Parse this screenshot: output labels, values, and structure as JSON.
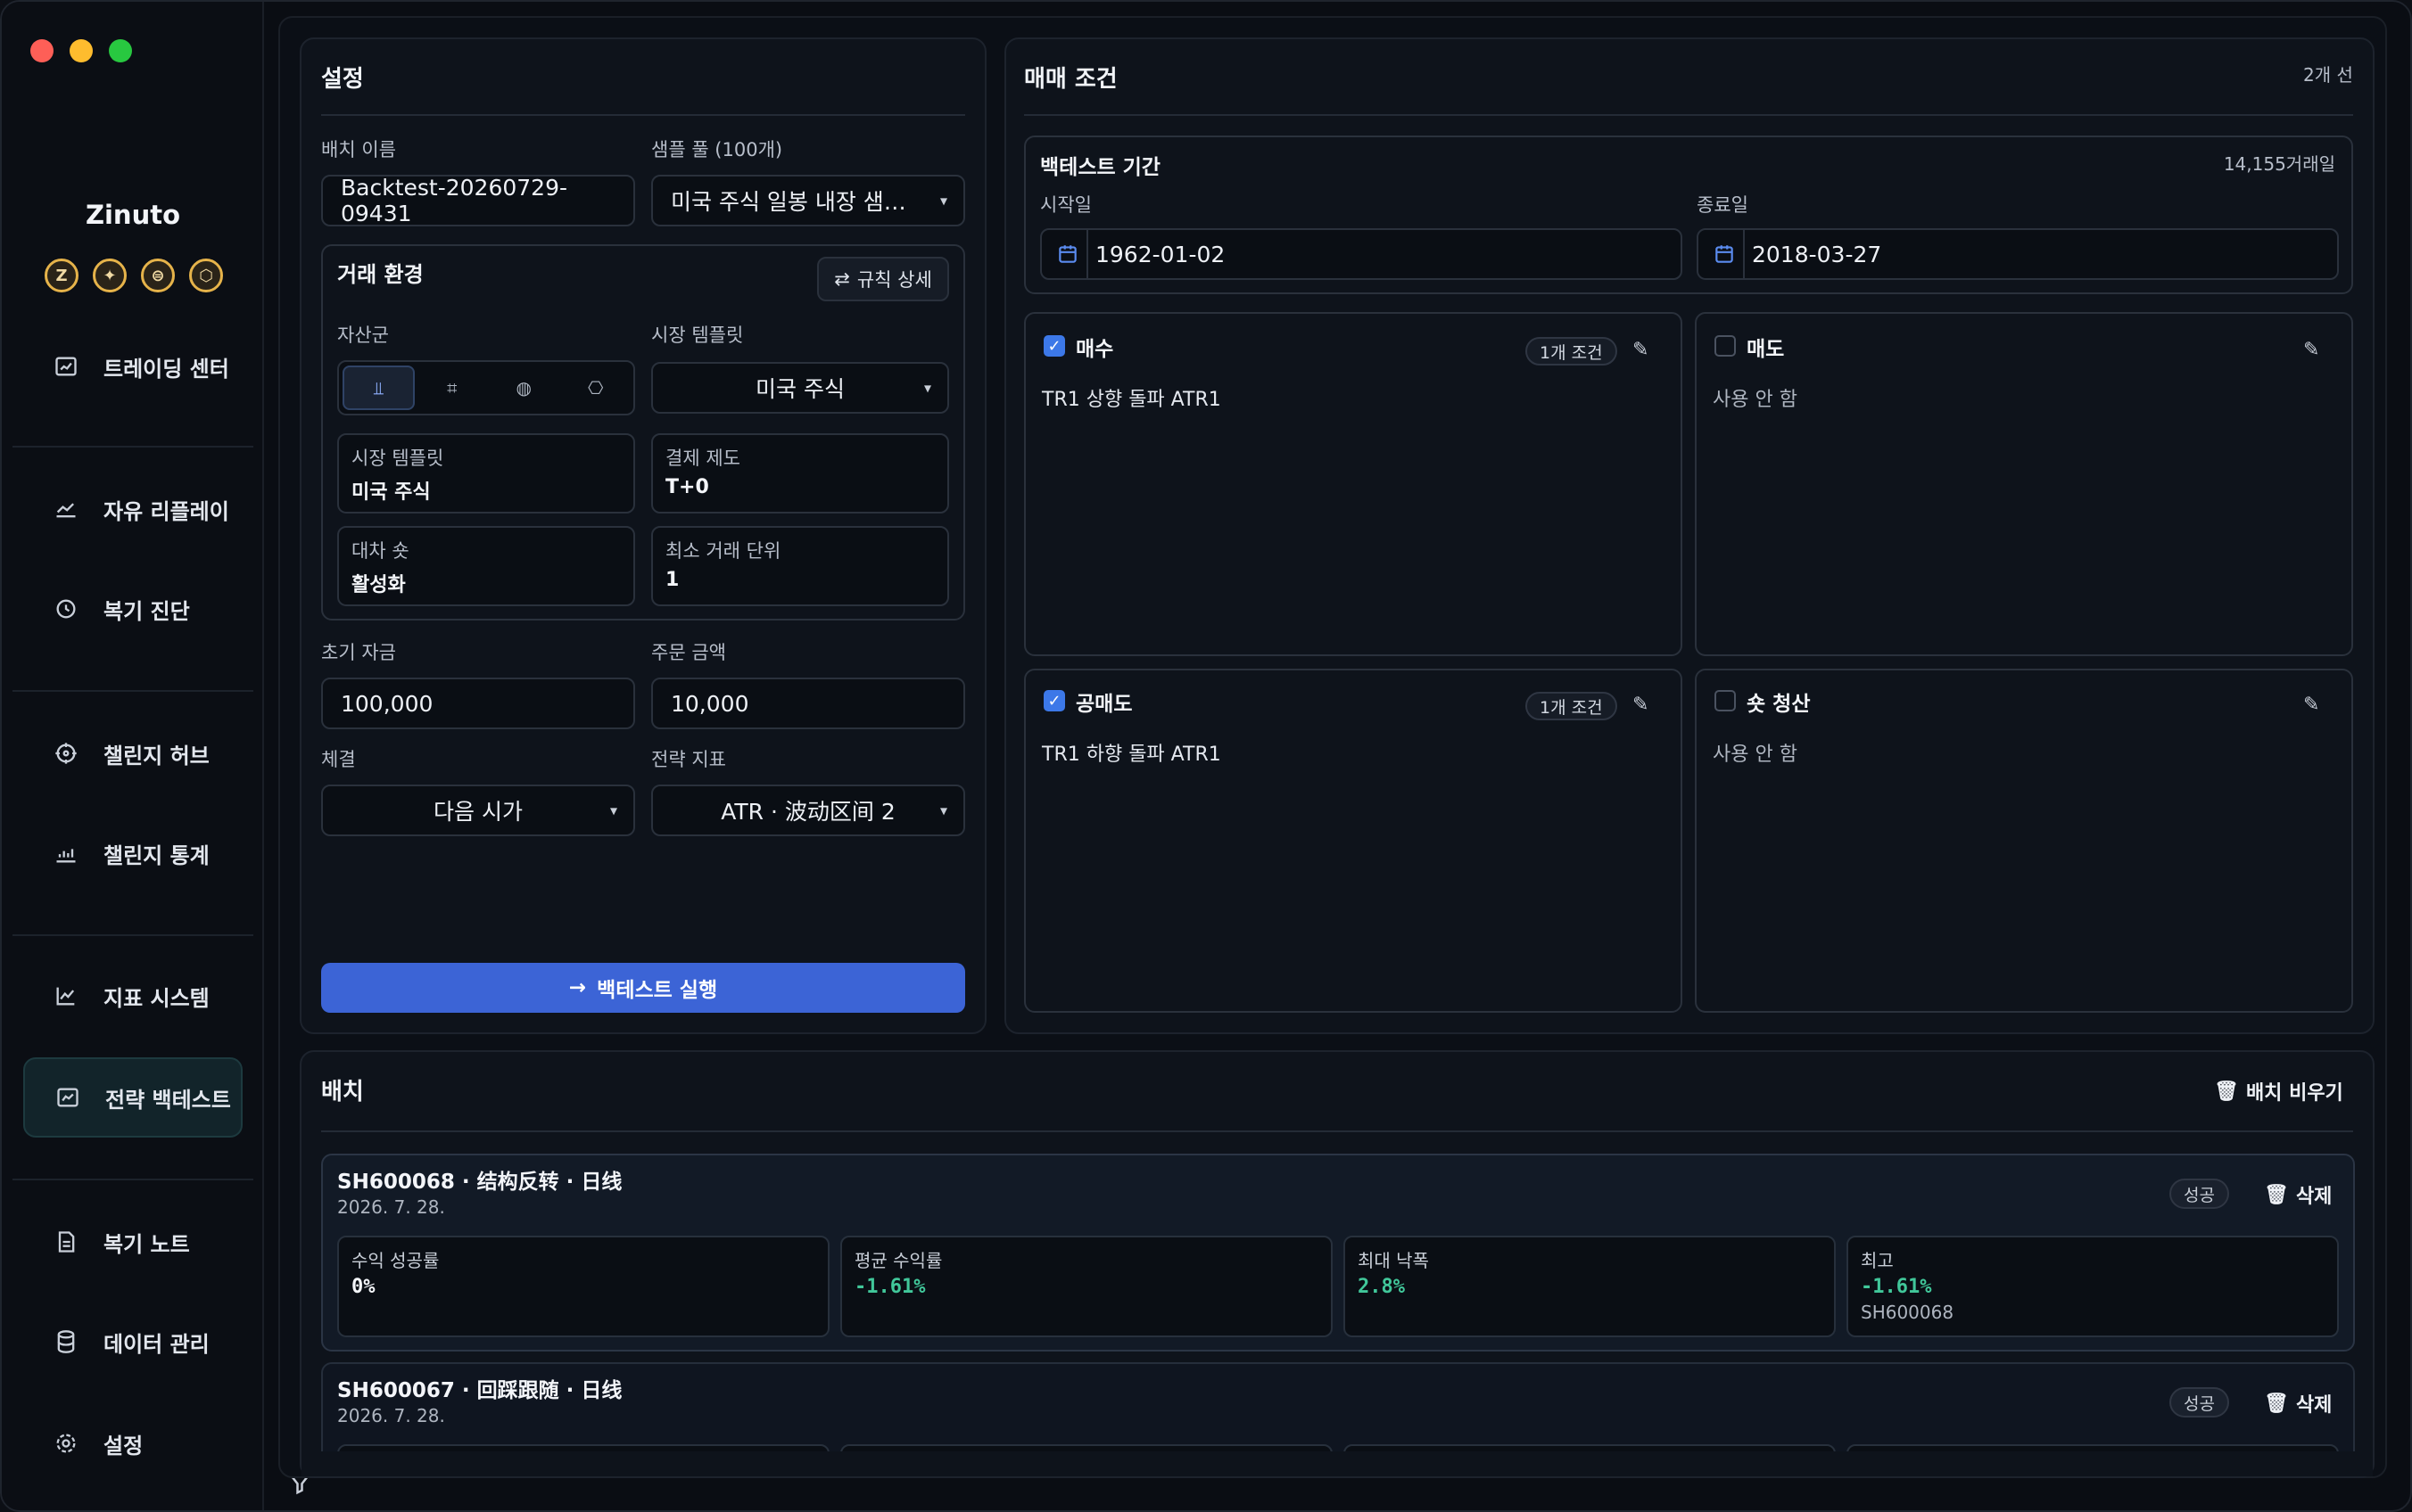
{
  "app": {
    "name": "Zinuto",
    "brand_icons": [
      "Z",
      "✦",
      "⊜",
      "⬡"
    ]
  },
  "sidebar": {
    "items": [
      {
        "label": "트레이딩 센터",
        "icon": "chart-window-icon"
      },
      {
        "label": "자유 리플레이",
        "icon": "trend-icon"
      },
      {
        "label": "복기 진단",
        "icon": "history-icon"
      },
      {
        "label": "챌린지 허브",
        "icon": "target-icon"
      },
      {
        "label": "챌린지 통계",
        "icon": "stats-icon"
      },
      {
        "label": "지표 시스템",
        "icon": "line-chart-icon"
      },
      {
        "label": "전략 백테스트",
        "icon": "backtest-icon",
        "active": true
      },
      {
        "label": "복기 노트",
        "icon": "note-icon"
      },
      {
        "label": "데이터 관리",
        "icon": "database-icon"
      },
      {
        "label": "설정",
        "icon": "gear-icon"
      }
    ]
  },
  "settings": {
    "title": "설정",
    "batch_name_label": "배치 이름",
    "batch_name_value": "Backtest-20260729-09431",
    "sample_pool_label": "샘플 풀 (100개)",
    "sample_pool_value": "미국 주식 일봉 내장 샘…",
    "env": {
      "title": "거래 환경",
      "rules_button": "규칙 상세",
      "asset_label": "자산군",
      "asset_options": [
        "⫫",
        "⌗",
        "◍",
        "⎔"
      ],
      "template_label": "시장 템플릿",
      "template_value": "미국 주식",
      "info": [
        {
          "k": "시장 템플릿",
          "v": "미국 주식"
        },
        {
          "k": "결제 제도",
          "v": "T+0"
        },
        {
          "k": "대차 숏",
          "v": "활성화"
        },
        {
          "k": "최소 거래 단위",
          "v": "1"
        }
      ]
    },
    "initial_capital_label": "초기 자금",
    "initial_capital_value": "100,000",
    "order_amount_label": "주문 금액",
    "order_amount_value": "10,000",
    "fill_label": "체결",
    "fill_value": "다음 시가",
    "indicator_label": "전략 지표",
    "indicator_value": "ATR · 波动区间 2",
    "run_button": "백테스트 실행"
  },
  "conditions": {
    "title": "매매 조건",
    "count_text": "2개 선",
    "period": {
      "title": "백테스트 기간",
      "days_text": "14,155거래일",
      "start_label": "시작일",
      "start_value": "1962-01-02",
      "end_label": "종료일",
      "end_value": "2018-03-27"
    },
    "cards": [
      {
        "name": "매수",
        "checked": true,
        "pill": "1개 조건",
        "text": "TR1 상향 돌파 ATR1"
      },
      {
        "name": "매도",
        "checked": false,
        "pill": "",
        "text": "사용 안 함"
      },
      {
        "name": "공매도",
        "checked": true,
        "pill": "1개 조건",
        "text": "TR1 하향 돌파 ATR1"
      },
      {
        "name": "숏 청산",
        "checked": false,
        "pill": "",
        "text": "사용 안 함"
      }
    ]
  },
  "batch": {
    "title": "배치",
    "clear_button": "배치 비우기",
    "rows": [
      {
        "title": "SH600068 · 结构反转 · 日线",
        "date": "2026. 7. 28.",
        "status": "성공",
        "delete": "삭제",
        "metrics": [
          {
            "k": "수익 성공률",
            "v": "0%",
            "green": false,
            "s": ""
          },
          {
            "k": "평균 수익률",
            "v": "-1.61%",
            "green": true,
            "s": ""
          },
          {
            "k": "최대 낙폭",
            "v": "2.8%",
            "green": true,
            "s": ""
          },
          {
            "k": "최고",
            "v": "-1.61%",
            "green": true,
            "s": "SH600068"
          }
        ]
      },
      {
        "title": "SH600067 · 回踩跟随 · 日线",
        "date": "2026. 7. 28.",
        "status": "성공",
        "delete": "삭제"
      }
    ]
  }
}
